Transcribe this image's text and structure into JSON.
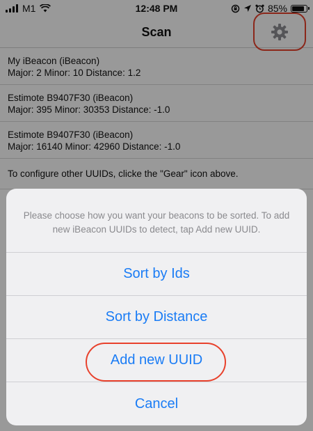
{
  "status_bar": {
    "carrier": "M1",
    "time": "12:48 PM",
    "battery_percent": "85%",
    "battery_level": 0.85
  },
  "nav": {
    "title": "Scan",
    "settings_icon": "gear-icon"
  },
  "beacons": [
    {
      "name": "My iBeacon (iBeacon)",
      "details": "Major: 2  Minor: 10  Distance: 1.2"
    },
    {
      "name": "Estimote B9407F30 (iBeacon)",
      "details": "Major: 395  Minor: 30353  Distance: -1.0"
    },
    {
      "name": "Estimote B9407F30 (iBeacon)",
      "details": "Major: 16140  Minor: 42960  Distance: -1.0"
    }
  ],
  "info_text": "To configure other UUIDs, clicke the \"Gear\" icon above.",
  "action_sheet": {
    "message": "Please choose how you want your beacons to be sorted.  To add new iBeacon UUIDs to detect, tap Add new UUID.",
    "actions": [
      "Sort by Ids",
      "Sort by Distance",
      "Add new UUID",
      "Cancel"
    ]
  },
  "colors": {
    "accent": "#1a7cf5",
    "highlight": "#e8412c"
  }
}
